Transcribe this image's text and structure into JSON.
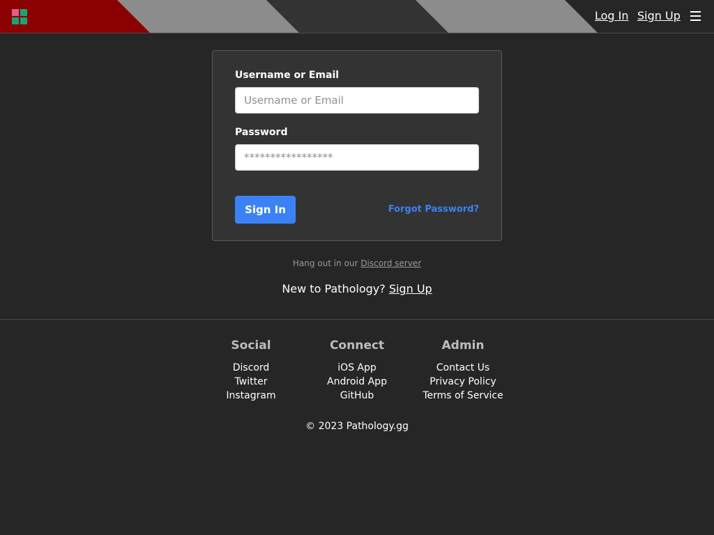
{
  "header": {
    "login_label": "Log In",
    "signup_label": "Sign Up",
    "logo_icon": "pathology-logo-icon",
    "menu_icon": "hamburger-menu-icon",
    "stripe_colors": [
      "#8b0000",
      "#8c8c8c",
      "#333333",
      "#8c8c8c",
      "#333333"
    ],
    "logo_colors": [
      "#e05c8a",
      "#1aa37a",
      "#1aa37a",
      "#1aa37a"
    ]
  },
  "login_form": {
    "username_label": "Username or Email",
    "username_placeholder": "Username or Email",
    "username_value": "",
    "password_label": "Password",
    "password_placeholder": "*****************",
    "password_value": "",
    "signin_label": "Sign In",
    "forgot_label": "Forgot Password?"
  },
  "discord": {
    "prefix": "Hang out in our ",
    "link": "Discord server"
  },
  "signup_prompt": {
    "prefix": "New to Pathology? ",
    "link": "Sign Up"
  },
  "footer": {
    "social": {
      "heading": "Social",
      "links": [
        "Discord",
        "Twitter",
        "Instagram"
      ]
    },
    "connect": {
      "heading": "Connect",
      "links": [
        "iOS App",
        "Android App",
        "GitHub"
      ]
    },
    "admin": {
      "heading": "Admin",
      "links": [
        "Contact Us",
        "Privacy Policy",
        "Terms of Service"
      ]
    },
    "copyright": "© 2023 Pathology.gg"
  },
  "colors": {
    "accent": "#3b82f6",
    "background": "#262626",
    "card": "#333333"
  }
}
